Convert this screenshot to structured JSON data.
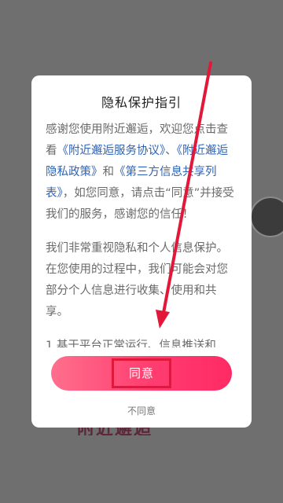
{
  "dialog": {
    "title": "隐私保护指引",
    "paragraph1": {
      "part1": "感谢您使用附近邂逅，欢迎您点击查看",
      "link1": "《附近邂逅服务协议》",
      "sep1": "、",
      "link2": "《附近邂逅隐私政策》",
      "and": "和",
      "link3": "《第三方信息共享列表》",
      "part2": "，如您同意，请点击“同意”并接受我们的服务，感谢您的信任！"
    },
    "paragraph2": "我们非常重视隐私和个人信息保护。在您使用的过程中，我们可能会对您部分个人信息进行收集、使用和共享。",
    "paragraph3": "1.基于平台正常运行、信息推送和",
    "agree_label": "同意",
    "disagree_label": "不同意"
  },
  "background": {
    "partial_text": "附近邂逅"
  },
  "colors": {
    "overlay": "#6f6f6f",
    "link": "#2f63b4",
    "button_start": "#ff6f8d",
    "button_end": "#ff2a64",
    "annotation": "#e1183a"
  }
}
